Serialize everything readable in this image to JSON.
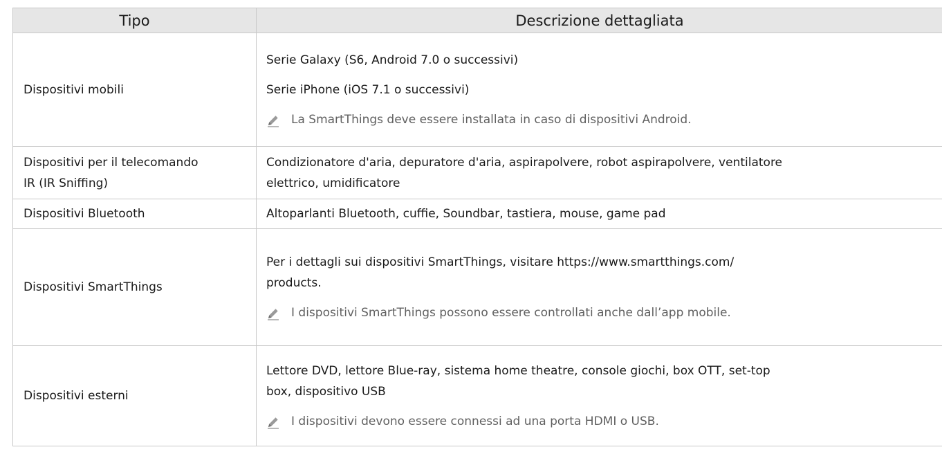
{
  "header": {
    "col_type": "Tipo",
    "col_desc": "Descrizione dettagliata"
  },
  "rows": [
    {
      "type": "Dispositivi mobili",
      "desc_lines": [
        "Serie Galaxy (S6, Android 7.0 o successivi)",
        "Serie iPhone (iOS 7.1 o successivi)"
      ],
      "note": "La SmartThings deve essere installata in caso di dispositivi Android.",
      "note_icon": "pencil-note-icon"
    },
    {
      "type_lines": [
        "Dispositivi per il telecomando",
        "IR (IR Sniffing)"
      ],
      "desc_lines": [
        "Condizionatore d'aria, depuratore d'aria, aspirapolvere, robot aspirapolvere, ventilatore",
        "elettrico, umidificatore"
      ]
    },
    {
      "type": "Dispositivi Bluetooth",
      "desc": "Altoparlanti Bluetooth, cuffie, Soundbar, tastiera, mouse, game pad"
    },
    {
      "type": "Dispositivi SmartThings",
      "desc_lines": [
        "Per i dettagli sui dispositivi SmartThings, visitare https://www.smartthings.com/",
        "products."
      ],
      "note": "I dispositivi SmartThings possono essere controllati anche dall’app mobile.",
      "note_icon": "pencil-note-icon"
    },
    {
      "type": "Dispositivi esterni",
      "desc_lines": [
        "Lettore DVD, lettore Blue-ray, sistema home theatre, console giochi, box OTT, set-top",
        "box, dispositivo USB"
      ],
      "note": "I dispositivi devono essere connessi ad una porta HDMI o USB.",
      "note_icon": "pencil-note-icon"
    }
  ],
  "colors": {
    "header_bg": "#e6e6e6",
    "border": "#c8c8c8",
    "text": "#1a1a1a",
    "note_text": "#606060"
  }
}
